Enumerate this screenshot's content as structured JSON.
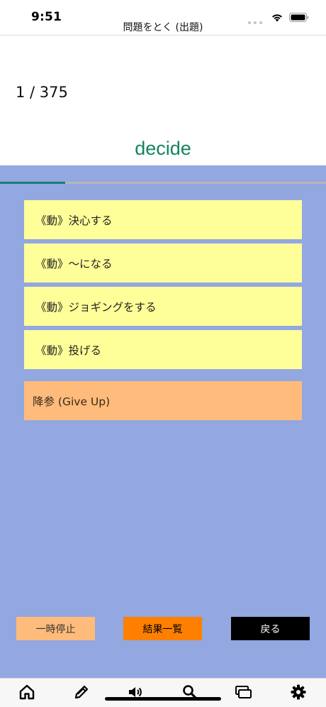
{
  "status_bar": {
    "time": "9:51",
    "icons": [
      "wifi-icon",
      "battery-icon"
    ]
  },
  "nav": {
    "title": "問題をとく (出題)"
  },
  "quiz": {
    "counter": "1 / 375",
    "word": "decide",
    "progress": 0.2,
    "choices": [
      {
        "label": "《動》決心する"
      },
      {
        "label": "《動》～になる"
      },
      {
        "label": "《動》ジョギングをする"
      },
      {
        "label": "《動》投げる"
      }
    ],
    "giveup_label": "降参 (Give Up)"
  },
  "buttons": {
    "pause": "一時停止",
    "results": "結果一覧",
    "back": "戻る"
  },
  "tab_bar": {
    "items": [
      "home-icon",
      "pencil-icon",
      "speaker-icon",
      "search-icon",
      "flashcards-icon",
      "gear-icon"
    ]
  },
  "colors": {
    "word": "#14845a",
    "quiz_background": "#93a7e1",
    "choice_background": "#ffff99",
    "giveup_background": "#ffbb7b",
    "pause_button": "#ffbb7b",
    "results_button": "#ff8000",
    "back_button": "#000000",
    "progress_fill": "#1a7d7a"
  }
}
